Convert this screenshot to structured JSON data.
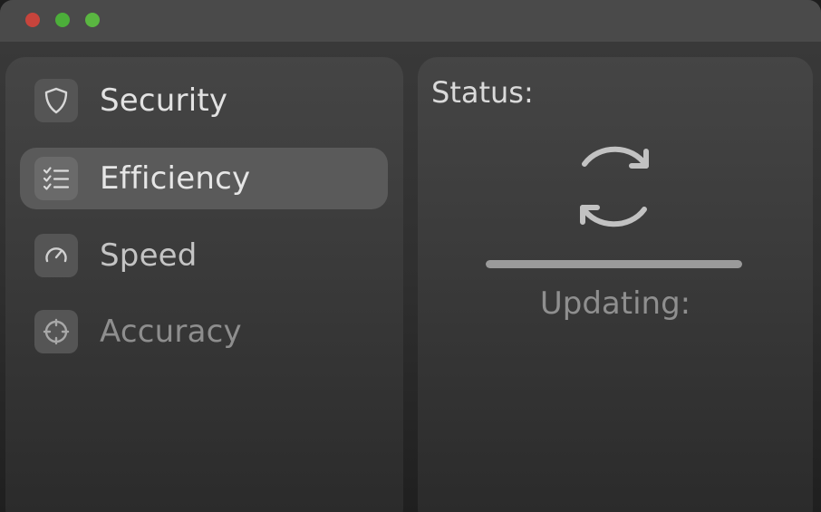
{
  "window": {
    "traffic_lights": {
      "close_color": "#c7443c",
      "minimize_color": "#4cae3a",
      "maximize_color": "#5ab641"
    }
  },
  "sidebar": {
    "items": [
      {
        "label": "Security",
        "icon": "shield-icon",
        "selected": false,
        "text_color": "#e2e2e2"
      },
      {
        "label": "Efficiency",
        "icon": "checklist-icon",
        "selected": true,
        "text_color": "#e6e6e6"
      },
      {
        "label": "Speed",
        "icon": "speedometer-icon",
        "selected": false,
        "text_color": "#c4c4c4"
      },
      {
        "label": "Accuracy",
        "icon": "crosshair-icon",
        "selected": false,
        "text_color": "#8e8e8e"
      }
    ]
  },
  "status_panel": {
    "title": "Status:",
    "icon": "refresh-icon",
    "progress": 1.0,
    "status_text": "Updating:"
  }
}
